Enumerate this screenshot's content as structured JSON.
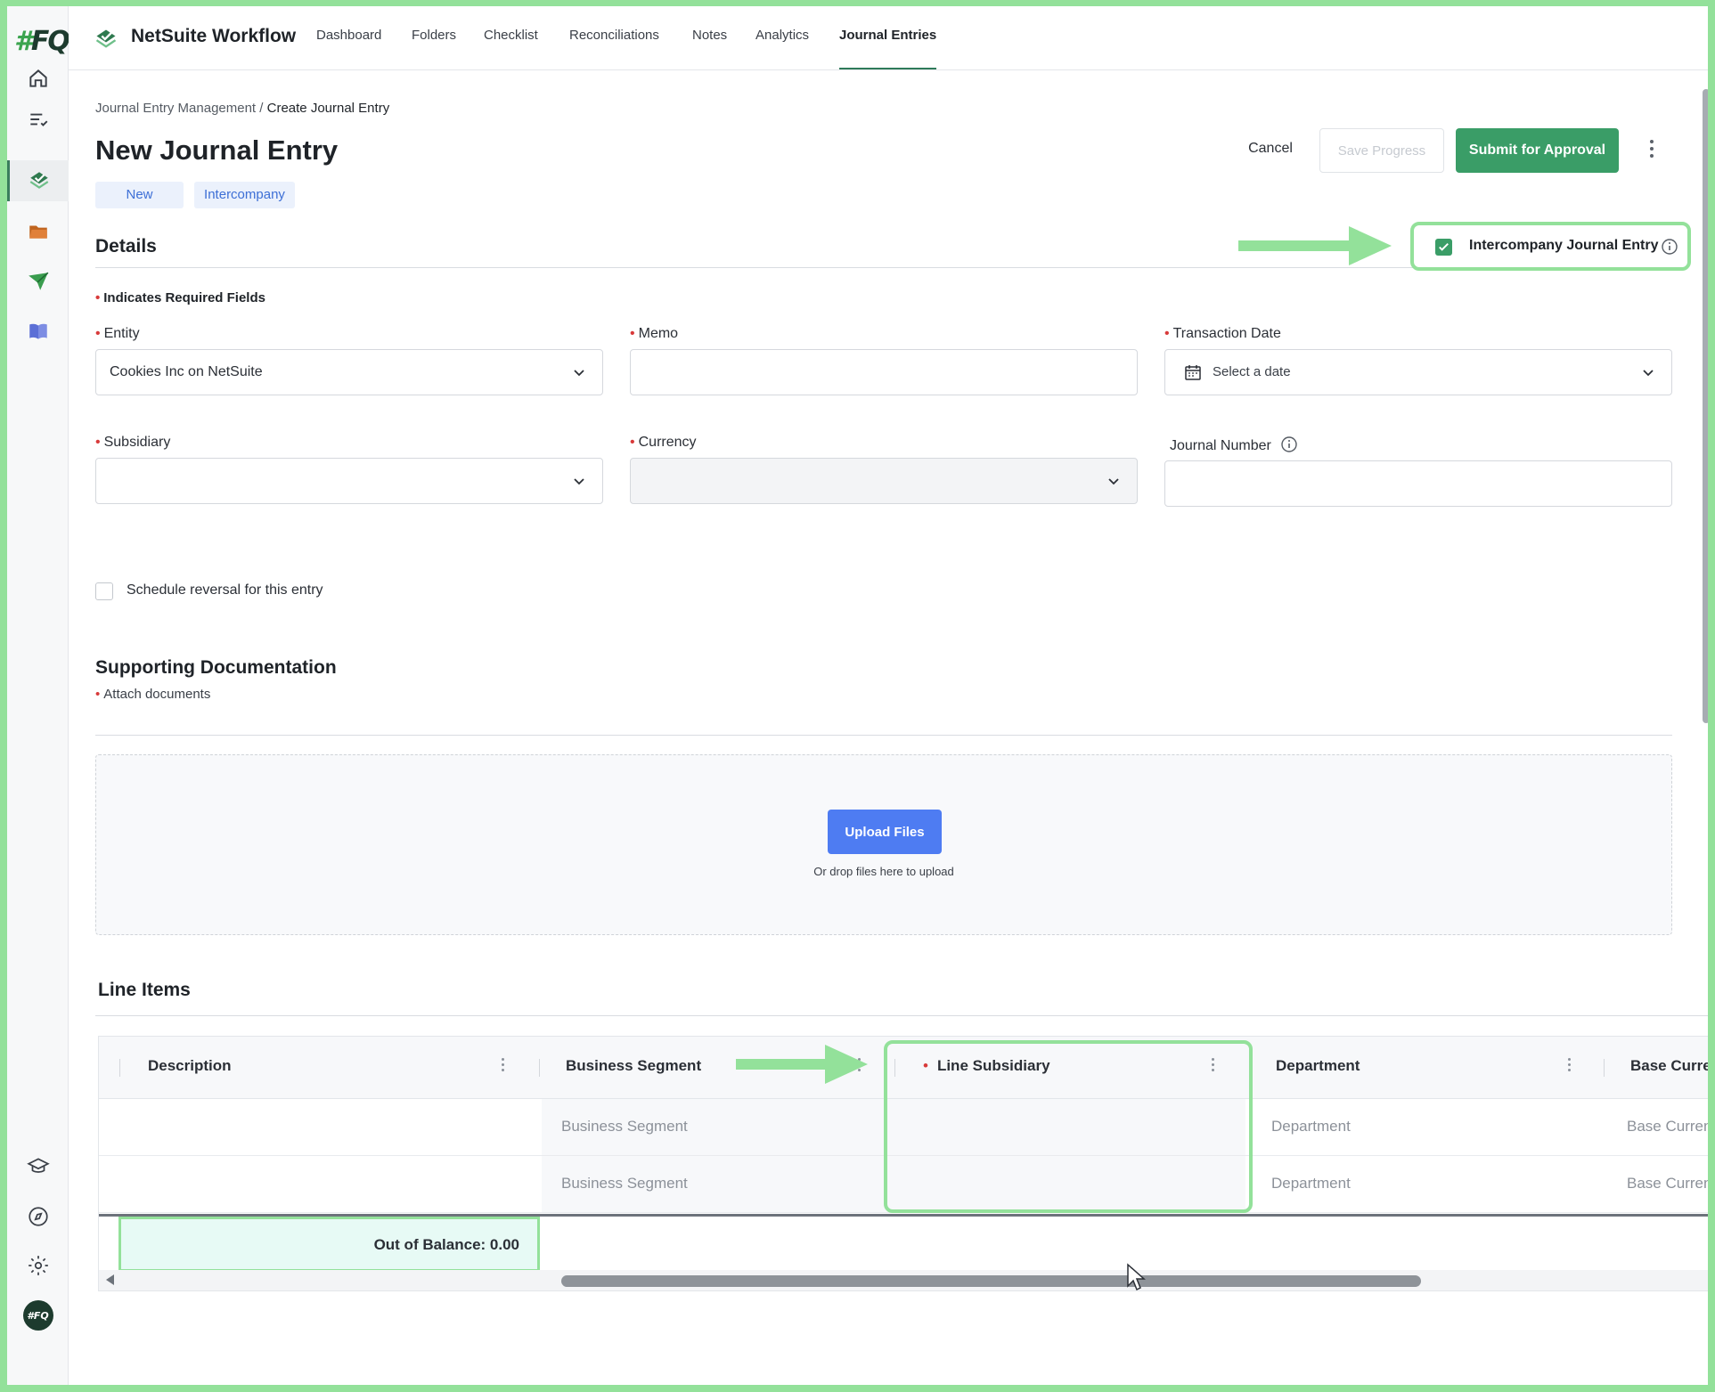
{
  "app": {
    "logo": "#FQ",
    "title": "NetSuite Workflow",
    "colors": {
      "accent": "#3a9d67",
      "primary_button": "#4e7cf2",
      "highlight": "#93e19a",
      "badge_text": "#3d6fd6"
    }
  },
  "nav": {
    "tabs": [
      {
        "label": "Dashboard"
      },
      {
        "label": "Folders"
      },
      {
        "label": "Checklist"
      },
      {
        "label": "Reconciliations"
      },
      {
        "label": "Notes"
      },
      {
        "label": "Analytics"
      },
      {
        "label": "Journal Entries",
        "active": true
      }
    ]
  },
  "sidebar": {
    "icons": [
      "home-icon",
      "tasks-icon",
      "workflow-icon",
      "folder-icon",
      "send-icon",
      "book-icon",
      "learning-icon",
      "compass-icon",
      "gear-icon",
      "user-avatar"
    ],
    "avatar_label": "#FQ"
  },
  "breadcrumb": {
    "parent": "Journal Entry Management",
    "separator": "/",
    "current": "Create Journal Entry"
  },
  "page": {
    "title": "New Journal Entry",
    "badges": [
      "New",
      "Intercompany"
    ]
  },
  "actions": {
    "cancel": "Cancel",
    "save": "Save Progress",
    "submit": "Submit for Approval"
  },
  "details": {
    "title": "Details",
    "intercompany_label": "Intercompany Journal Entry",
    "intercompany_checked": true,
    "required_note": "Indicates Required Fields",
    "fields": {
      "entity": {
        "label": "Entity",
        "value": "Cookies Inc on NetSuite"
      },
      "memo": {
        "label": "Memo",
        "value": ""
      },
      "transaction_date": {
        "label": "Transaction Date",
        "placeholder": "Select a date"
      },
      "subsidiary": {
        "label": "Subsidiary",
        "value": ""
      },
      "currency": {
        "label": "Currency",
        "value": ""
      },
      "journal_number": {
        "label": "Journal Number",
        "value": ""
      }
    },
    "schedule_reversal": "Schedule reversal for this entry"
  },
  "documentation": {
    "title": "Supporting Documentation",
    "attach": "Attach documents",
    "upload_button": "Upload Files",
    "drop_hint": "Or drop files here to upload"
  },
  "line_items": {
    "title": "Line Items",
    "columns": [
      "Description",
      "Business Segment",
      "Line Subsidiary",
      "Department",
      "Base Curre"
    ],
    "rows": [
      {
        "description": "",
        "business_segment": "Business Segment",
        "line_subsidiary": "",
        "department": "Department",
        "base_currency": "Base Curren"
      },
      {
        "description": "",
        "business_segment": "Business Segment",
        "line_subsidiary": "",
        "department": "Department",
        "base_currency": "Base Curren"
      }
    ],
    "out_of_balance": "Out of Balance: 0.00"
  }
}
